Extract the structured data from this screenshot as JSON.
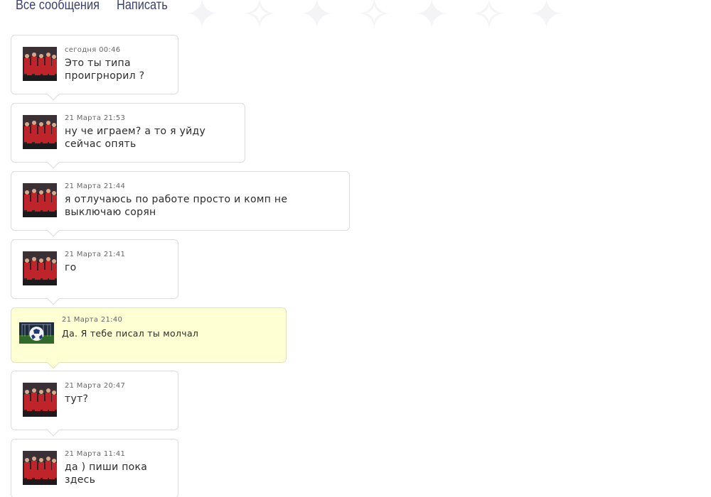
{
  "nav": {
    "all_messages": "Все сообщения",
    "write": "Написать"
  },
  "messages": [
    {
      "time": "сегодня 00:46",
      "text": "Это ты типа\nпроигрнорил ?",
      "avatar": "team-photo",
      "highlighted": false
    },
    {
      "time": "21 Марта 21:53",
      "text": "ну че играем? а то я уйду\nсейчас опять",
      "avatar": "team-photo",
      "highlighted": false
    },
    {
      "time": "21 Марта 21:44",
      "text": "я отлучаюсь по работе просто и комп не\nвыключаю сорян",
      "avatar": "team-photo",
      "highlighted": false
    },
    {
      "time": "21 Марта 21:41",
      "text": "го",
      "avatar": "team-photo",
      "highlighted": false
    },
    {
      "time": "21 Марта 21:40",
      "text": "Да. Я тебе писал ты молчал",
      "avatar": "soccer-ball",
      "highlighted": true
    },
    {
      "time": "21 Марта 20:47",
      "text": "тут?",
      "avatar": "team-photo",
      "highlighted": false
    },
    {
      "time": "21 Марта 11:41",
      "text": "да ) пиши пока\nздесь",
      "avatar": "team-photo",
      "highlighted": false
    }
  ],
  "colors": {
    "nav_text": "#3b3f6e",
    "bubble_border": "#dcdcdc",
    "highlight_bg": "#ffffd4",
    "team_red": "#c0242b"
  }
}
